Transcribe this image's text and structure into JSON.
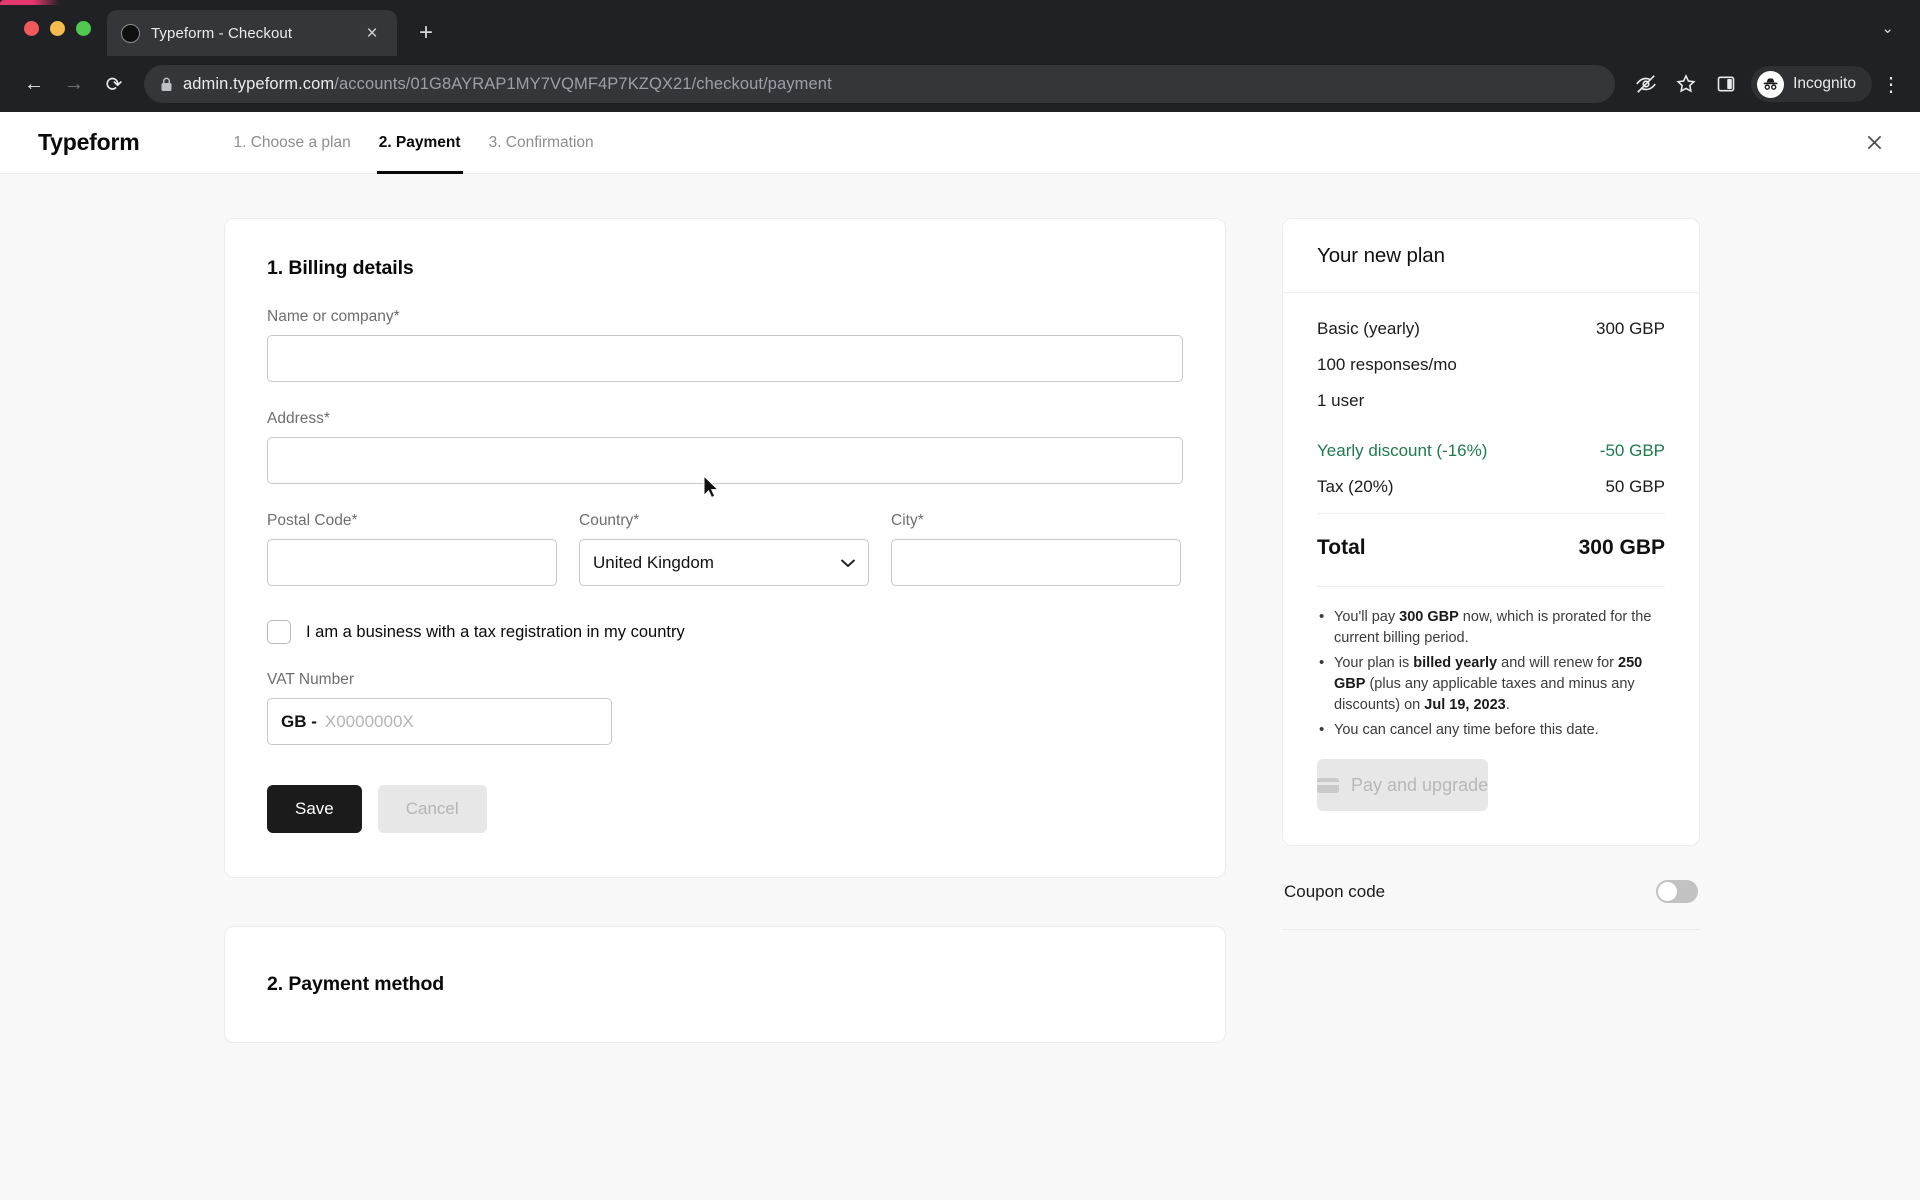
{
  "browser": {
    "tab": {
      "title": "Typeform - Checkout",
      "favicon": "circle-favicon",
      "close": "×",
      "new_tab": "+"
    },
    "tabstrip_chevron": "⌄",
    "nav": {
      "back": "←",
      "forward": "→",
      "reload": "⟳"
    },
    "address": {
      "host": "admin.typeform.com",
      "path": "/accounts/01G8AYRAP1MY7VQMF4P7KZQX21/checkout/payment",
      "lock_icon": "lock-icon"
    },
    "profile": {
      "label": "Incognito"
    },
    "icons": {
      "tracking": "eye-off-icon",
      "bookmark": "star-icon",
      "side_panel": "side-panel-icon",
      "menu": "⋮"
    }
  },
  "app": {
    "brand": "Typeform",
    "steps": [
      {
        "label": "1. Choose a plan",
        "active": false
      },
      {
        "label": "2. Payment",
        "active": true
      },
      {
        "label": "3. Confirmation",
        "active": false
      }
    ],
    "close_label": "×"
  },
  "billing": {
    "title": "1. Billing details",
    "name_label": "Name or company*",
    "name_value": "",
    "name_placeholder": "",
    "address_label": "Address*",
    "address_value": "",
    "address_placeholder": "",
    "postal_label": "Postal Code*",
    "postal_value": "",
    "postal_placeholder": "",
    "country_label": "Country*",
    "country_value": "United Kingdom",
    "country_caret": "⌄",
    "city_label": "City*",
    "city_value": "",
    "city_placeholder": "",
    "business_checkbox_label": "I am a business with a tax registration in my country",
    "business_checked": false,
    "vat_label": "VAT Number",
    "vat_prefix": "GB -",
    "vat_placeholder": "X0000000X",
    "vat_value": "",
    "save_label": "Save",
    "cancel_label": "Cancel"
  },
  "payment_method": {
    "title": "2. Payment method"
  },
  "plan": {
    "heading": "Your new plan",
    "name": "Basic (yearly)",
    "price": "300 GBP",
    "feature_responses": "100 responses/mo",
    "feature_users": "1 user",
    "discount_label": "Yearly discount (-16%)",
    "discount_amount": "-50 GBP",
    "tax_label": "Tax (20%)",
    "tax_amount": "50 GBP",
    "total_label": "Total",
    "total_amount": "300 GBP",
    "notes": [
      {
        "parts": [
          "You'll pay ",
          "300 GBP",
          " now, which is prorated for the current billing period."
        ]
      },
      {
        "parts": [
          "Your plan is ",
          "billed yearly",
          " and will renew for ",
          "250 GBP",
          " (plus any applicable taxes and minus any discounts) on ",
          "Jul 19, 2023",
          "."
        ]
      },
      {
        "parts": [
          "You can cancel any time before this date."
        ]
      }
    ],
    "pay_button_label": "Pay and upgrade",
    "pay_button_icon": "credit-card-icon",
    "pay_button_disabled": true
  },
  "coupon": {
    "label": "Coupon code",
    "enabled": false
  },
  "colors": {
    "accent_dark": "#1b1b1b",
    "discount_green": "#1f7a4d",
    "chrome_dark": "#202124",
    "tab_active": "#35363a",
    "page_bg": "#f8f8f8"
  }
}
